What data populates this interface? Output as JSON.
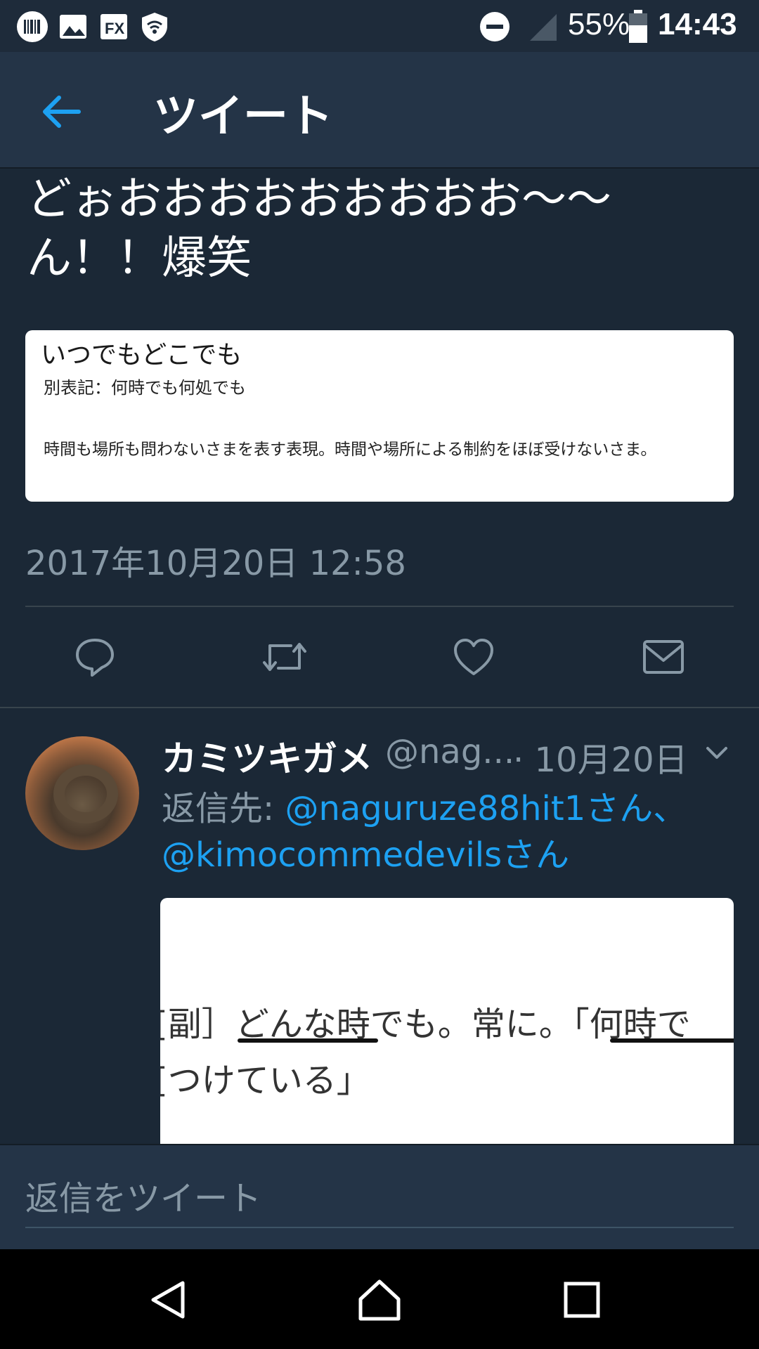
{
  "status_bar": {
    "battery_percent": "55%",
    "time": "14:43",
    "icons": [
      "barcode-icon",
      "image-icon",
      "fx-app-icon",
      "shield-wifi-icon",
      "do-not-disturb-icon",
      "signal-icon",
      "battery-icon"
    ]
  },
  "header": {
    "title": "ツイート",
    "back_icon": "arrow-left-icon",
    "accent_color": "#1da1f2"
  },
  "tweet": {
    "text": "どぉおおおおおおおおお〜〜ん！！爆笑",
    "image": {
      "title": "いつでもどこでも",
      "line1": "別表記：何時でも何処でも",
      "line2": "時間も場所も問わないさまを表す表現。時間や場所による制約をほぼ受けないさま。"
    },
    "timestamp": "2017年10月20日 12:58",
    "actions": [
      "reply-icon",
      "retweet-icon",
      "like-icon",
      "share-mail-icon"
    ]
  },
  "reply": {
    "name": "カミツキガメ",
    "handle": "@nag...",
    "date": "· 10月20日",
    "reply_to_label": "返信先: ",
    "mention1": "@naguruze88hit1さん、",
    "mention2": "@kimocommedevilsさん",
    "image": {
      "line1": "[副］どんな時でも。常に。「何時で",
      "line2": "[つけている」"
    }
  },
  "composer": {
    "placeholder": "返信をツイート"
  },
  "nav": {
    "buttons": [
      "back-triangle-icon",
      "home-icon",
      "recents-icon"
    ]
  }
}
